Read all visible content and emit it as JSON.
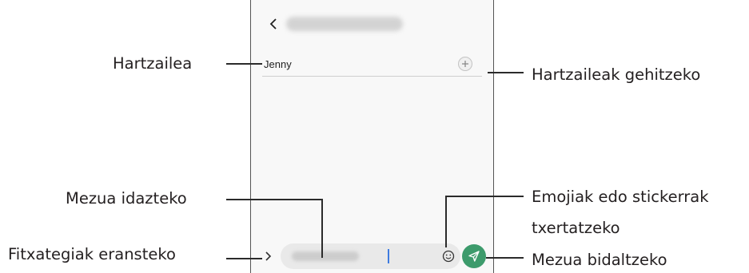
{
  "phone": {
    "recipient": {
      "name": "Jenny"
    }
  },
  "callouts": {
    "recipient": "Hartzailea",
    "add_recipients": "Hartzaileak gehitzeko",
    "enter_message": "Mezua idazteko",
    "emoji_line1": "Emojiak edo stickerrak",
    "emoji_line2": "txertatzeko",
    "attach_files": "Fitxategiak eransteko",
    "send_message": "Mezua bidaltzeko"
  },
  "colors": {
    "send_button": "#3d9b6c",
    "cursor": "#3e7be0",
    "input_background": "#e9e9e9"
  },
  "icons": {
    "back": "chevron-left-icon",
    "add": "plus-icon",
    "expand": "chevron-right-icon",
    "emoji": "smiley-icon",
    "send": "paper-plane-icon"
  }
}
